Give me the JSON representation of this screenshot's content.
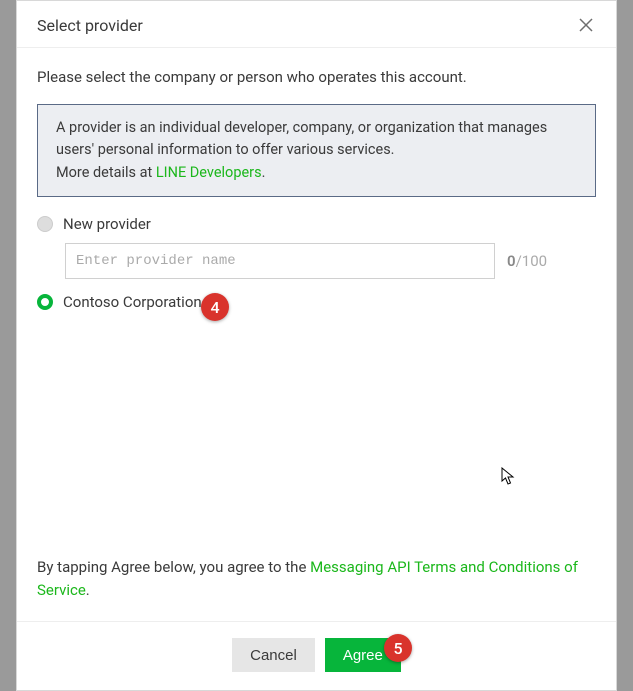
{
  "modal": {
    "title": "Select provider",
    "instruction": "Please select the company or person who operates this account.",
    "info_text_1": "A provider is an individual developer, company, or organization that manages users' personal information to offer various services.",
    "info_text_2": "More details at ",
    "info_link": "LINE Developers",
    "info_text_3": ".",
    "options": {
      "new_provider_label": "New provider",
      "existing_label": "Contoso Corporation"
    },
    "input": {
      "placeholder": "Enter provider name",
      "counter_current": "0",
      "counter_max": "/100"
    },
    "agree_prefix": "By tapping Agree below, you agree to the ",
    "agree_link": "Messaging API Terms and Conditions of Service",
    "agree_suffix": ".",
    "buttons": {
      "cancel": "Cancel",
      "agree": "Agree"
    }
  },
  "annotations": {
    "badge4": "4",
    "badge5": "5"
  }
}
